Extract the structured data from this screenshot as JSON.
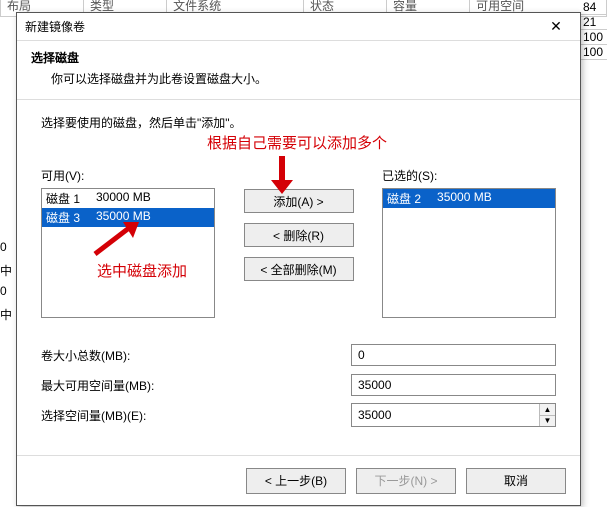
{
  "bg": {
    "headers": [
      "布局",
      "类型",
      "文件系统",
      "状态",
      "容量",
      "可用空间"
    ],
    "rightCells": [
      "84",
      "21",
      "100",
      "100"
    ],
    "sideCells": [
      "0",
      "中",
      "0",
      "中"
    ]
  },
  "dialog": {
    "title": "新建镜像卷",
    "close": "✕",
    "header": {
      "h1": "选择磁盘",
      "sub": "你可以选择磁盘并为此卷设置磁盘大小。"
    },
    "instruction": "选择要使用的磁盘，然后单击\"添加\"。",
    "annotations": {
      "top": "根据自己需要可以添加多个",
      "mid": "选中磁盘添加"
    },
    "available": {
      "label": "可用(V):",
      "items": [
        {
          "name": "磁盘 1",
          "size": "30000 MB",
          "selected": false
        },
        {
          "name": "磁盘 3",
          "size": "35000 MB",
          "selected": true
        }
      ]
    },
    "selected": {
      "label": "已选的(S):",
      "items": [
        {
          "name": "磁盘 2",
          "size": "35000 MB",
          "selected": true
        }
      ]
    },
    "buttons": {
      "add": "添加(A) >",
      "remove": "< 删除(R)",
      "removeAll": "< 全部删除(M)"
    },
    "fields": {
      "totalLabel": "卷大小总数(MB):",
      "totalValue": "0",
      "maxLabel": "最大可用空间量(MB):",
      "maxValue": "35000",
      "selectLabel": "选择空间量(MB)(E):",
      "selectValue": "35000"
    },
    "footer": {
      "back": "< 上一步(B)",
      "next": "下一步(N) >",
      "cancel": "取消"
    }
  }
}
